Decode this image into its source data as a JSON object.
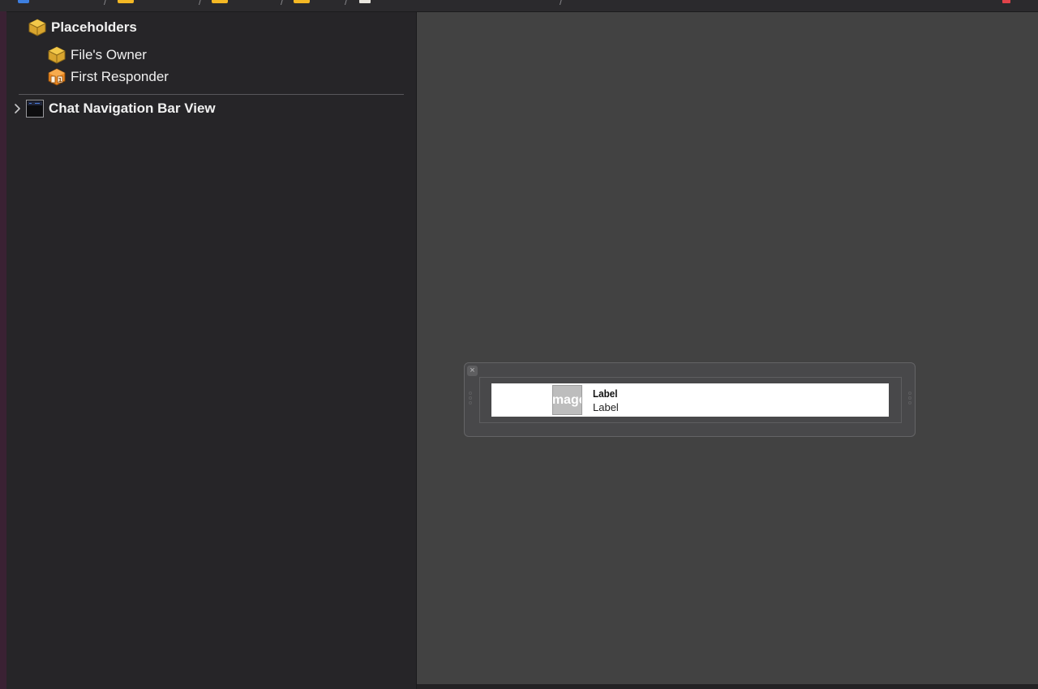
{
  "outline": {
    "placeholders_label": "Placeholders",
    "items": [
      {
        "label": "File's Owner",
        "icon": "cube-icon"
      },
      {
        "label": "First Responder",
        "icon": "first-responder-icon"
      }
    ],
    "top_view": {
      "label": "Chat Navigation Bar View",
      "icon": "view-thumbnail-icon",
      "expanded": false
    }
  },
  "canvas": {
    "background": "#424242",
    "scene": {
      "title_label": "Label",
      "subtitle_label": "Label",
      "image_placeholder": "Image"
    }
  },
  "colors": {
    "sidebar_bg": "#262528",
    "canvas_bg": "#424242",
    "placeholder_cube": "#e7b43a",
    "first_responder": "#f08a24",
    "window_edge": "#3a2133"
  }
}
